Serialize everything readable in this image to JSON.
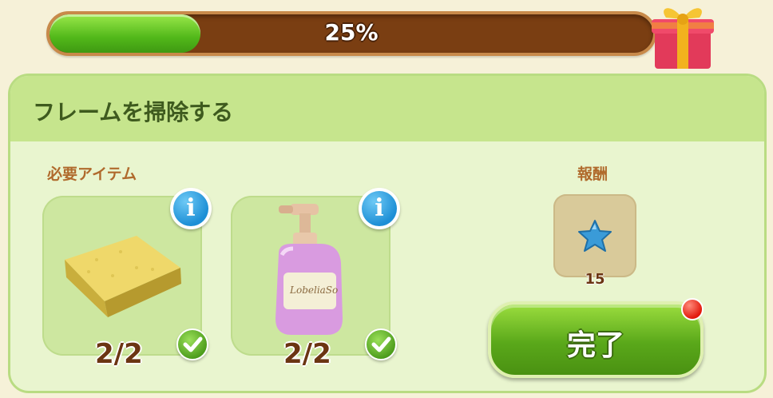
{
  "progress": {
    "value": 0.25,
    "label": "25%"
  },
  "task": {
    "title": "フレームを掃除する",
    "required_label": "必要アイテム",
    "reward_label": "報酬",
    "items": [
      {
        "name": "sponge",
        "count": "2/2"
      },
      {
        "name": "soap-bottle",
        "count": "2/2"
      }
    ],
    "reward": {
      "icon": "blue-star-icon",
      "amount": "15"
    },
    "complete_button": "完了"
  },
  "colors": {
    "progress_fill": "#5ab820",
    "progress_track": "#7a3e12",
    "panel_bg": "#e9f5cf",
    "header_bg": "#c6e58d",
    "button_green": "#5aa81a",
    "notify_red": "#e21a0c"
  }
}
